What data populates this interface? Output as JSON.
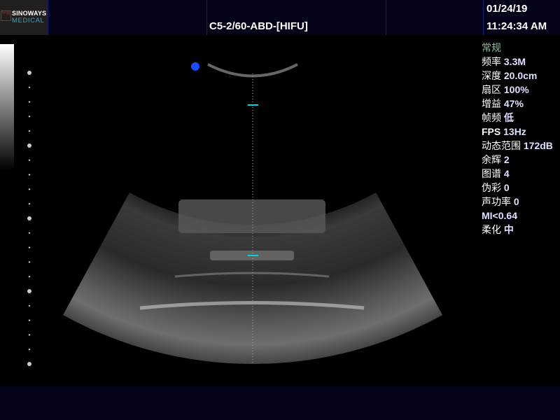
{
  "header": {
    "brand_line1": "SINOWAYS",
    "brand_line2": "MEDICAL",
    "seal_text": "中惠",
    "probe_preset": "C5-2/60-ABD-[HIFU]",
    "date": "01/24/19",
    "time": "11:24:34 AM"
  },
  "params": {
    "mode": "常规",
    "rows": [
      {
        "label": "频率",
        "value": "3.3M"
      },
      {
        "label": "深度",
        "value": "20.0cm"
      },
      {
        "label": "扇区",
        "value": "100%"
      },
      {
        "label": "增益",
        "value": "47%"
      },
      {
        "label": "帧频",
        "value": "低"
      },
      {
        "label": "FPS",
        "value": "13Hz"
      },
      {
        "label": "动态范围",
        "value": "172dB"
      },
      {
        "label": "余辉",
        "value": "2"
      },
      {
        "label": "图谱",
        "value": "4"
      },
      {
        "label": "伪彩",
        "value": "0"
      },
      {
        "label": "声功率",
        "value": "0"
      },
      {
        "label": "MI<0.64",
        "value": ""
      },
      {
        "label": "柔化",
        "value": "中"
      }
    ]
  },
  "colors": {
    "header_bg": "#03031a",
    "marker": "#00d8e0",
    "focus_dot": "#1a4cff"
  }
}
